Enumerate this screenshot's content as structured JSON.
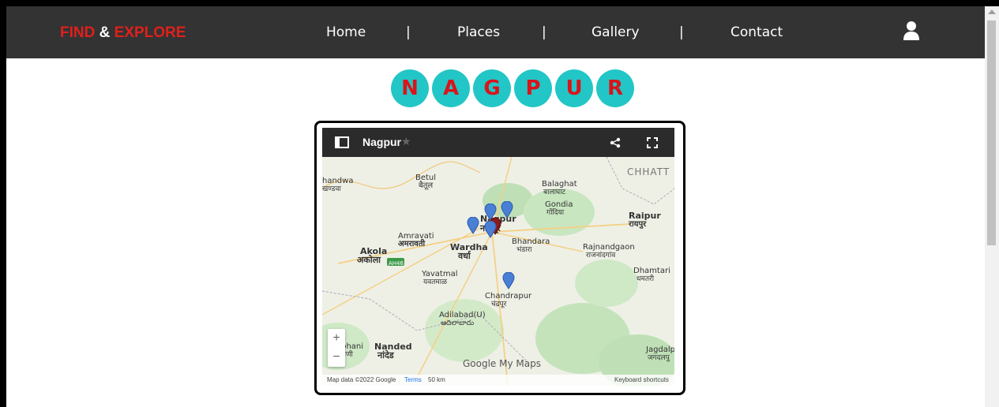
{
  "navbar": {
    "brand_part1": "FIND",
    "brand_amp": " & ",
    "brand_part2": "EXPLORE",
    "items": [
      "Home",
      "Places",
      "Gallery",
      "Contact"
    ],
    "separator": "|",
    "user_icon": "user-icon"
  },
  "city_letters": [
    "N",
    "A",
    "G",
    "P",
    "U",
    "R"
  ],
  "map": {
    "title": "Nagpur",
    "star": "★",
    "places": {
      "chhatt": "CHHATT",
      "betul": "Betul",
      "betul_hi": "बैतूल",
      "khandwa": "handwa",
      "khandwa_hi": "खण्डवा",
      "balaghat": "Balaghat",
      "balaghat_hi": "बालाघाट",
      "gondia": "Gondia",
      "gondia_hi": "गोंदिया",
      "raipur": "Raipur",
      "raipur_hi": "रायपुर",
      "nagpur": "Nagpur",
      "nagpur_hi": "नागपूर",
      "amravati": "Amravati",
      "amravati_hi": "अमरावती",
      "bhandara": "Bhandara",
      "bhandara_hi": "भंडारा",
      "wardha": "Wardha",
      "wardha_hi": "वर्धा",
      "akola": "Akola",
      "akola_hi": "अकोला",
      "rajnandgaon": "Rajnandgaon",
      "rajnandgaon_hi": "राजनांदगांव",
      "dhamtari": "Dhamtari",
      "dhamtari_hi": "धमतरी",
      "yavatmal": "Yavatmal",
      "yavatmal_hi": "यवतमाळ",
      "chandrapur": "Chandrapur",
      "chandrapur_hi": "चंद्रपूर",
      "adilabad": "Adilabad(U)",
      "adilabad_hi": "ఆదిలాబాదు",
      "nanded": "Nanded",
      "nanded_hi": "नांदेड",
      "parbhani": "rbhani",
      "parbhani_hi": "रभणी",
      "jagdalpur": "Jagdalp",
      "jagdalpur_hi": "जगदलपु",
      "highway": "AH46"
    },
    "zoom_in": "+",
    "zoom_out": "−",
    "brand": "Google My Maps",
    "footer_data": "Map data ©2022 Google",
    "footer_terms": "Terms",
    "footer_scale": "50 km",
    "footer_shortcuts": "Keyboard shortcuts",
    "pin_color": "#4a7fd6"
  }
}
